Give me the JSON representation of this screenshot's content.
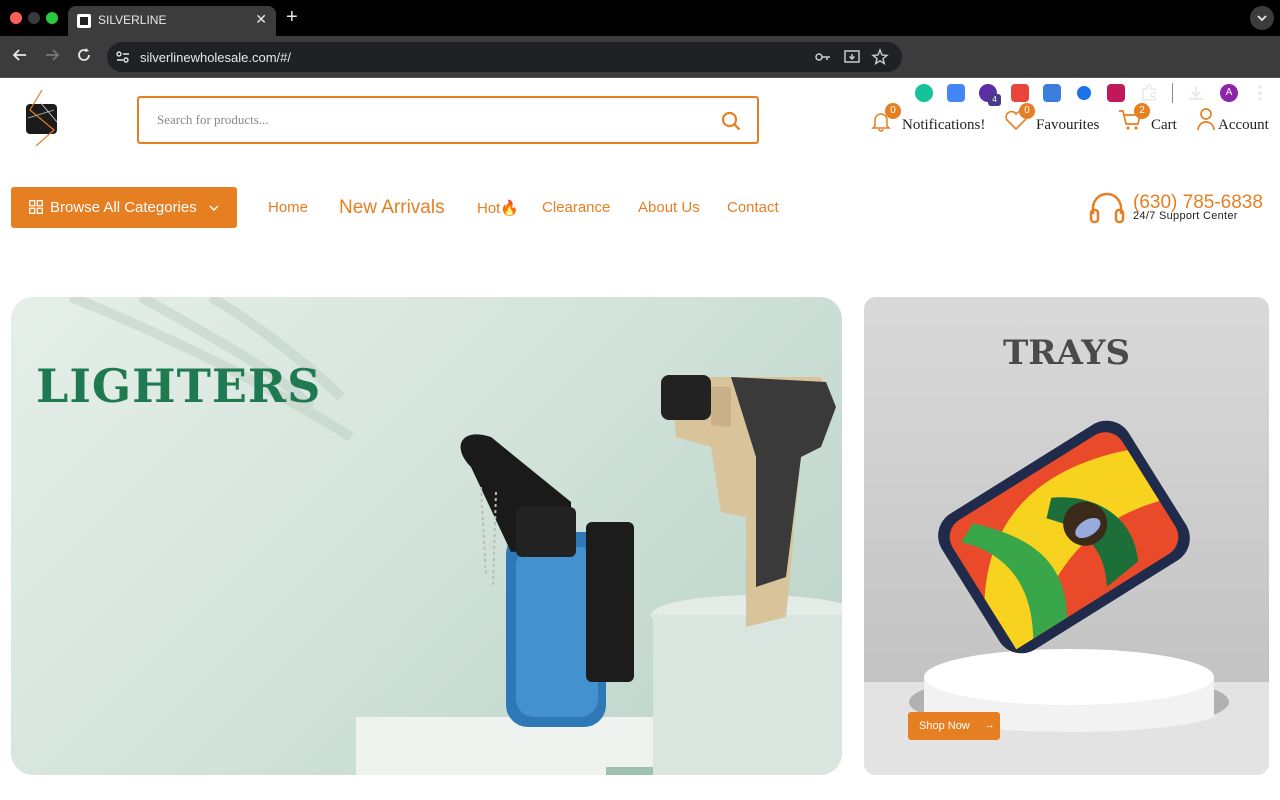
{
  "browser": {
    "tab_title": "SILVERLINE",
    "url": "silverlinewholesale.com/#/",
    "profile_initial": "A",
    "extension_badge": "4"
  },
  "header": {
    "search_placeholder": "Search for products...",
    "notifications": {
      "label": "Notifications!",
      "count": "0"
    },
    "favourites": {
      "label": "Favourites",
      "count": "0"
    },
    "cart": {
      "label": "Cart",
      "count": "2"
    },
    "account": {
      "label": "Account"
    }
  },
  "nav": {
    "browse_label": "Browse All Categories",
    "links": [
      "Home",
      "New Arrivals",
      "Hot🔥",
      "Clearance",
      "About Us",
      "Contact"
    ],
    "phone": "(630) 785-6838",
    "support_text": "24/7 Support Center"
  },
  "banners": {
    "main_title": "LIGHTERS",
    "side_title": "TRAYS",
    "shop_now": "Shop Now",
    "shop_arrow": "→"
  },
  "colors": {
    "accent": "#e67e22",
    "lighters_title": "#1f7a51",
    "trays_title": "#4a4a4a"
  }
}
